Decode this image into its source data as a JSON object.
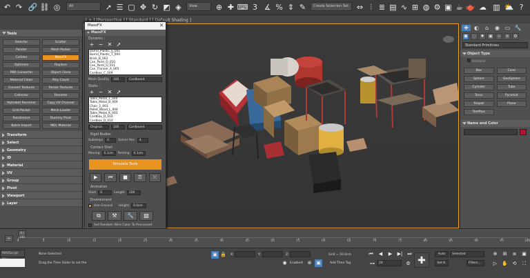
{
  "toolbar": {
    "selection_filter": "All",
    "view_dropdown": "View",
    "selection_set": "Create Selection Set",
    "icons": [
      "undo-icon",
      "redo-icon",
      "link-icon",
      "unlink-icon",
      "bind-spacewarp-icon",
      "select-icon",
      "select-by-name-icon",
      "rect-select-icon",
      "window-crossing-icon",
      "move-icon",
      "rotate-icon",
      "scale-icon",
      "pivot-icon",
      "snap-icon",
      "angle-snap-icon",
      "percent-snap-icon",
      "spinner-snap-icon",
      "mirror-icon",
      "align-icon",
      "layers-icon",
      "scene-explorer-icon",
      "curve-editor-icon",
      "schematic-icon",
      "material-editor-icon",
      "render-setup-icon",
      "render-frame-icon",
      "render-icon",
      "teapot-icon"
    ]
  },
  "left_panel": {
    "tools_header": "Tools",
    "tools": [
      [
        "Selector",
        "Scatter"
      ],
      [
        "Painter",
        "Mesh Packer"
      ],
      [
        "Collider",
        "MassFX"
      ],
      [
        "Optimize",
        "Replace"
      ],
      [
        "PBR Converter",
        "Object Clone"
      ],
      [
        "Material Clean",
        "Poly Count"
      ],
      [
        "Convert Textures",
        "Resize Textures"
      ],
      [
        "Collector",
        "Rename"
      ],
      [
        "Alphabet Renamer",
        "Copy UV Channel"
      ],
      [
        "Grid Packer",
        "Mesh Loader"
      ],
      [
        "Randomize",
        "Dummy Pivot"
      ],
      [
        "Batch Import",
        "MDL Material"
      ]
    ],
    "active_tool": "MassFX",
    "rollouts": [
      "Transform",
      "Select",
      "Geometry",
      "ID",
      "Material",
      "UV",
      "Group",
      "Pivot",
      "Viewport",
      "Layer"
    ]
  },
  "viewport": {
    "label": "[ + ] [Perspective ] [ Standard ] [ Default Shading ]"
  },
  "massfx": {
    "title": "MassFX",
    "section": "MassFX",
    "dynamic_label": "Dynamic :",
    "dynamic_list": [
      "Barrel_Plastic_S_001",
      "Barrel_Plastic_T_004",
      "Brick_B_003",
      "Can_Paint_O_010",
      "Can_Paint_O_011",
      "Can_Thinner_A_005",
      "Cardbox_C_009"
    ],
    "mesh_quality_label": "Mesh Quality",
    "mesh_quality_value": "100",
    "mesh_type": "Cardboard",
    "static_label": "Static :",
    "static_list": [
      "Table_Metal_1_004",
      "Table_Metal_B_009",
      "Chair_1_003",
      "Pallet_Wood_L_004",
      "Table_Metal_K_003",
      "Cardbox_D_016",
      "Cardbox_D_010"
    ],
    "material_type": "Original",
    "static_quality": "100",
    "static_type": "Cardboard",
    "rigid_bodies_label": "Rigid Bodies",
    "substeps_label": "Substeps",
    "substeps_value": "0",
    "solver_label": "Solver Iter.",
    "solver_value": "4",
    "contact_shell_label": "Contact Shell",
    "moving_label": "Moving",
    "moving_value": "0.1cm",
    "resting_label": "Resting",
    "resting_value": "0.1cm",
    "simulate_button": "Simulate Tools",
    "animation_label": "Animation",
    "start_label": "Start",
    "start_value": "0",
    "length_label": "Length",
    "length_value": "100",
    "environment_label": "Environment",
    "use_ground_label": "Use Ground",
    "height_label": "Height",
    "height_value": "0.0cm",
    "random_color_label": "Set Random Wire Color To Processed"
  },
  "right_panel": {
    "category": "Standard Primitives",
    "object_type_header": "Object Type",
    "autogrid": "AutoGrid",
    "primitives": [
      [
        "Box",
        "Cone"
      ],
      [
        "Sphere",
        "GeoSphere"
      ],
      [
        "Cylinder",
        "Tube"
      ],
      [
        "Torus",
        "Pyramid"
      ],
      [
        "Teapot",
        "Plane"
      ],
      [
        "TextPlus",
        ""
      ]
    ],
    "name_color_header": "Name and Color",
    "swatch_color": "#b01535"
  },
  "timeline": {
    "ticks": [
      "0",
      "5",
      "10",
      "15",
      "20",
      "25",
      "30",
      "35",
      "40",
      "45",
      "50",
      "55",
      "60",
      "65",
      "70",
      "75",
      "80",
      "85",
      "90",
      "95",
      "100"
    ],
    "frame_counter": "0 / 100"
  },
  "status": {
    "maxscript": "MAXScript Mini",
    "selection_text": "None Selected",
    "prompt_text": "Drag the Time Slider to set the",
    "x_label": "X:",
    "y_label": "Y:",
    "z_label": "Z:",
    "grid_text": "Grid = 10.0cm",
    "enabled_label": "Enabled:",
    "add_time_tag": "Add Time Tag",
    "frame_value": "24",
    "key_mode": "Auto",
    "set_key": "Set K.",
    "selected_dropdown": "Selected",
    "filters": "Filters..."
  }
}
